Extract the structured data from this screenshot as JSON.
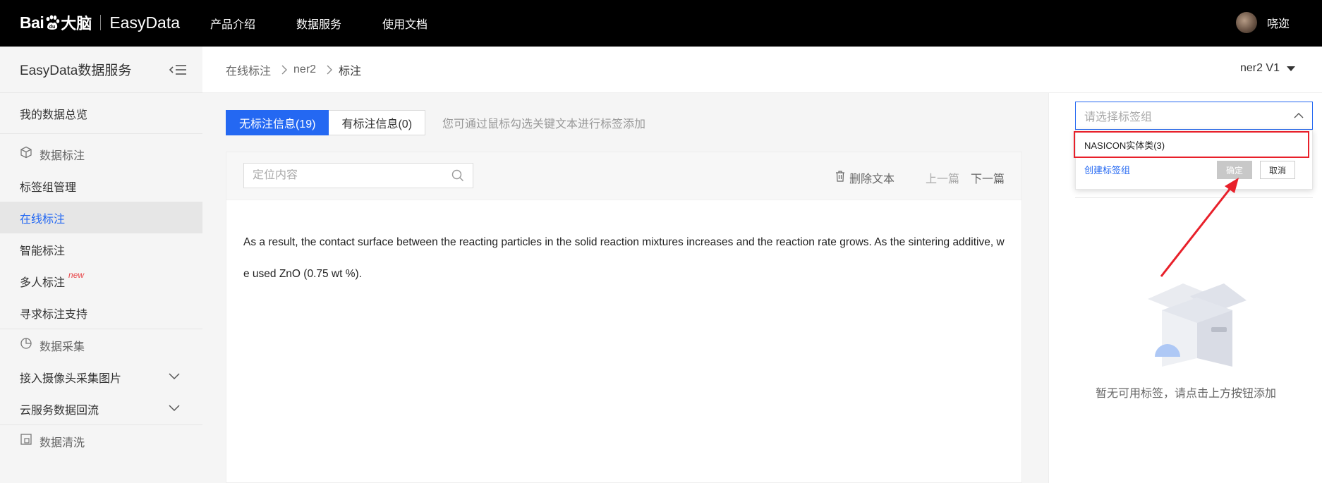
{
  "header": {
    "logo_bai": "Bai",
    "logo_danao": "大脑",
    "logo_product": "EasyData",
    "nav": [
      "产品介绍",
      "数据服务",
      "使用文档"
    ],
    "username": "哓迩"
  },
  "sidebar": {
    "title": "EasyData数据服务",
    "overview": "我的数据总览",
    "group_annotation": "数据标注",
    "label_group_mgmt": "标签组管理",
    "online_annotation": "在线标注",
    "smart_annotation": "智能标注",
    "multi_annotation": "多人标注",
    "multi_new_badge": "new",
    "seek_support": "寻求标注支持",
    "group_collection": "数据采集",
    "camera_collect": "接入摄像头采集图片",
    "cloud_backflow": "云服务数据回流",
    "group_cleaning": "数据清洗"
  },
  "breadcrumb": {
    "items": [
      "在线标注",
      "ner2",
      "标注"
    ],
    "version": "ner2 V1"
  },
  "main": {
    "tabs": [
      "无标注信息(19)",
      "有标注信息(0)"
    ],
    "hint": "您可通过鼠标勾选关键文本进行标签添加",
    "search_placeholder": "定位内容",
    "delete_label": "删除文本",
    "prev_label": "上一篇",
    "next_label": "下一篇",
    "text": "As a result, the contact surface between the reacting particles in the solid reaction mixtures increases and the reaction rate grows. As the sintering additive, we used ZnO (0.75 wt %)."
  },
  "right_panel": {
    "select_placeholder": "请选择标签组",
    "option": "NASICON实体类(3)",
    "create_label": "创建标签组",
    "confirm_label": "确定",
    "cancel_label": "取消",
    "empty_text": "暂无可用标签，请点击上方按钮添加"
  },
  "colors": {
    "accent": "#2468f2",
    "highlight": "#e8202a",
    "topbar": "#000000"
  }
}
